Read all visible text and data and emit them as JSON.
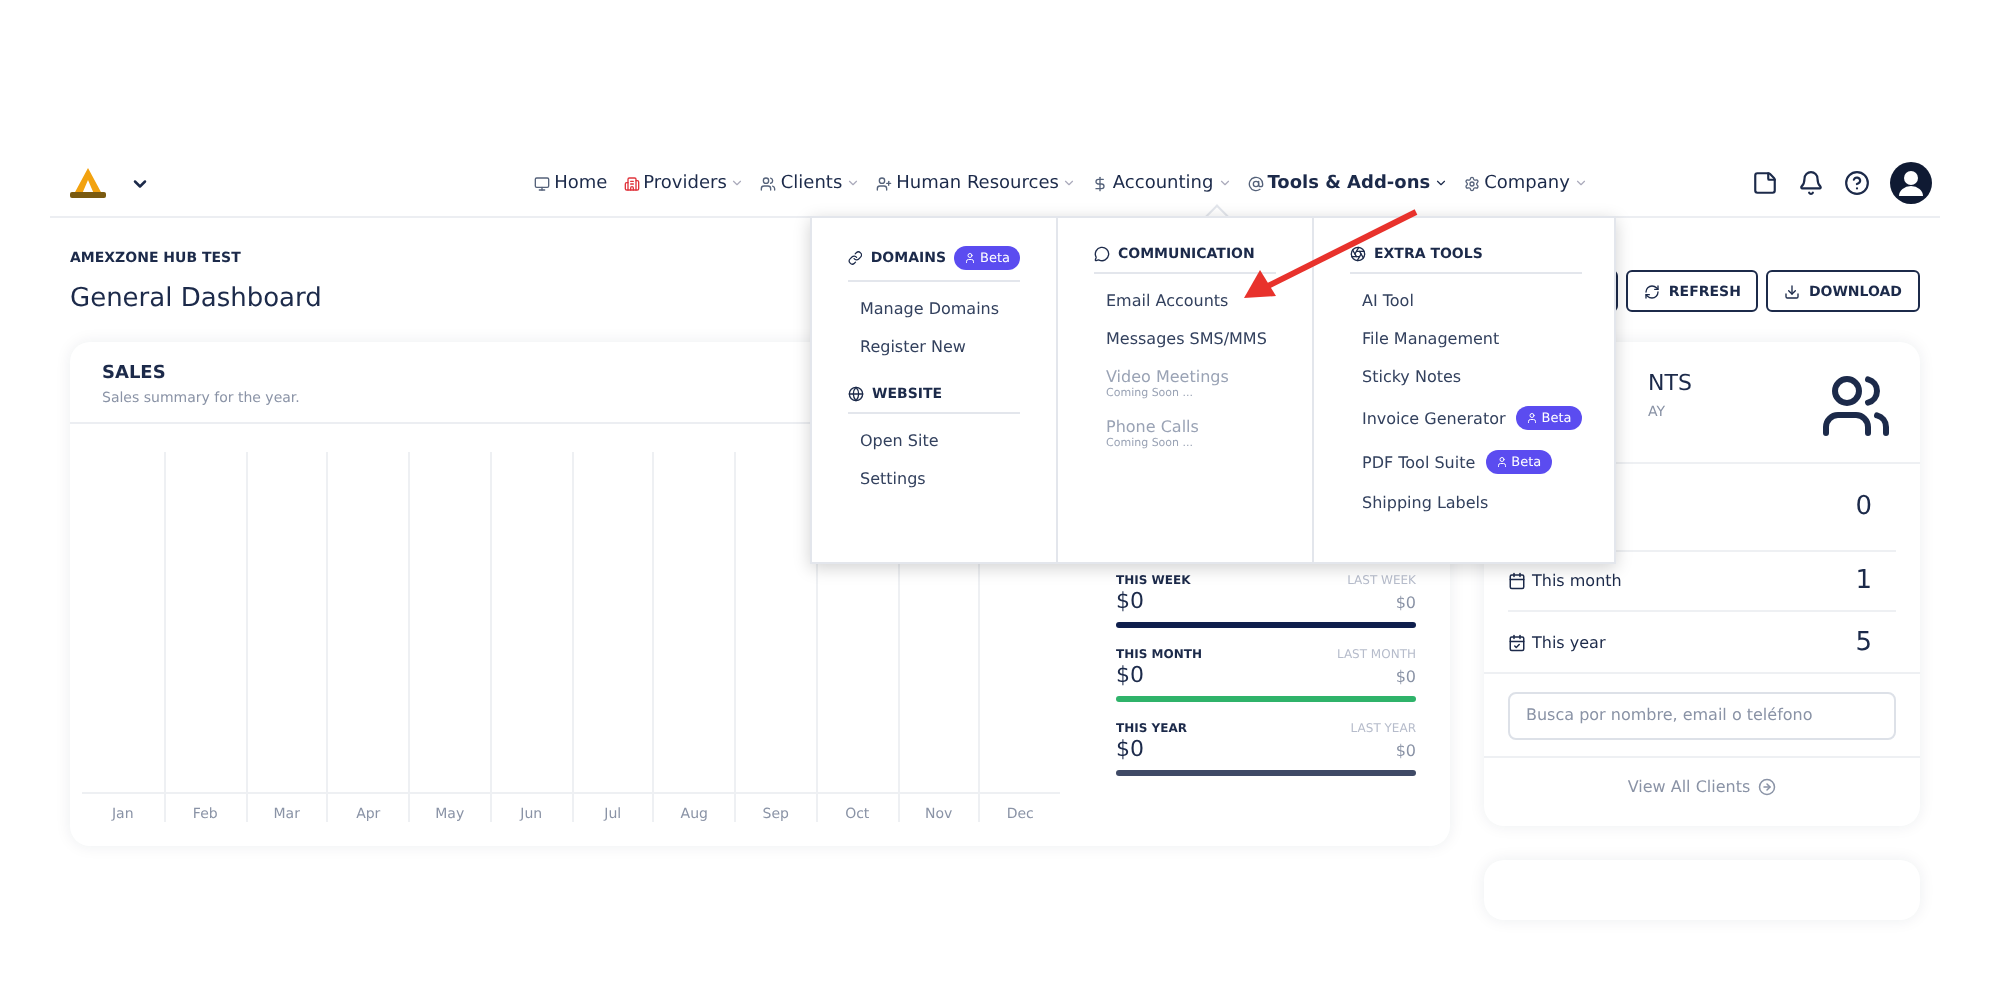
{
  "nav": {
    "items": [
      {
        "label": "Home",
        "menu": false,
        "expanded": false
      },
      {
        "label": "Providers",
        "menu": true,
        "expanded": false
      },
      {
        "label": "Clients",
        "menu": true,
        "expanded": false
      },
      {
        "label": "Human Resources",
        "menu": true,
        "expanded": false
      },
      {
        "label": "Accounting",
        "menu": true,
        "expanded": false
      },
      {
        "label": "Tools & Add-ons",
        "menu": true,
        "expanded": true
      },
      {
        "label": "Company",
        "menu": true,
        "expanded": false
      }
    ]
  },
  "breadcrumb": "AMEXZONE HUB TEST",
  "title": "General Dashboard",
  "actions": [
    {
      "label": "REFRESH"
    },
    {
      "label": "DOWNLOAD"
    }
  ],
  "sales": {
    "title": "SALES",
    "subtitle": "Sales summary for the year.",
    "months": [
      "Jan",
      "Feb",
      "Mar",
      "Apr",
      "May",
      "Jun",
      "Jul",
      "Aug",
      "Sep",
      "Oct",
      "Nov",
      "Dec"
    ],
    "stats": [
      {
        "label": "THIS WEEK",
        "compare_label": "LAST WEEK",
        "value": "$0",
        "compare_value": "$0",
        "color": "#0f1f4d"
      },
      {
        "label": "THIS MONTH",
        "compare_label": "LAST MONTH",
        "value": "$0",
        "compare_value": "$0",
        "color": "#2fb36a"
      },
      {
        "label": "THIS YEAR",
        "compare_label": "LAST YEAR",
        "value": "$0",
        "compare_value": "$0",
        "color": "#3f4a66"
      }
    ]
  },
  "clients": {
    "title": "NTS",
    "subtitle": "AY",
    "rows": [
      {
        "value": "0"
      },
      {
        "label": "This month",
        "value": "1"
      },
      {
        "label": "This year",
        "value": "5"
      }
    ],
    "search": {
      "placeholder": "Busca por nombre, email o teléfono"
    },
    "link": "View All Clients"
  },
  "menu": {
    "columns": [
      {
        "sections": [
          {
            "title": "DOMAINS",
            "badge": "Beta",
            "items": [
              {
                "label": "Manage Domains",
                "disabled": false
              },
              {
                "label": "Register New",
                "disabled": false
              }
            ]
          },
          {
            "title": "WEBSITE",
            "items": [
              {
                "label": "Open Site",
                "disabled": false
              },
              {
                "label": "Settings",
                "disabled": false
              }
            ]
          }
        ]
      },
      {
        "sections": [
          {
            "title": "COMMUNICATION",
            "items": [
              {
                "label": "Email Accounts",
                "disabled": false
              },
              {
                "label": "Messages SMS/MMS",
                "disabled": false
              },
              {
                "label": "Video Meetings",
                "note": "Coming Soon ...",
                "disabled": true
              },
              {
                "label": "Phone Calls",
                "note": "Coming Soon ...",
                "disabled": true
              }
            ]
          }
        ]
      },
      {
        "sections": [
          {
            "title": "EXTRA TOOLS",
            "items": [
              {
                "label": "AI Tool",
                "disabled": false
              },
              {
                "label": "File Management",
                "disabled": false
              },
              {
                "label": "Sticky Notes",
                "disabled": false
              },
              {
                "label": "Invoice Generator",
                "badge": "Beta",
                "disabled": false
              },
              {
                "label": "PDF Tool Suite",
                "badge": "Beta",
                "disabled": false
              },
              {
                "label": "Shipping Labels",
                "disabled": false
              }
            ]
          }
        ]
      }
    ]
  },
  "annotation": {
    "kind": "arrow"
  }
}
